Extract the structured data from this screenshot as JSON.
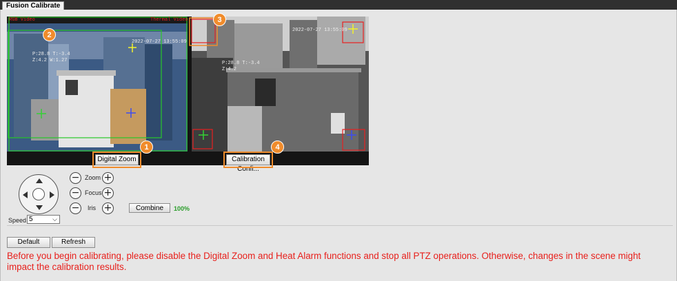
{
  "tab": {
    "label": "Fusion Calibrate"
  },
  "video": {
    "left_timestamp": "2022-07-27 13:55:09",
    "left_coords_1": "P:28.8  T:-3.4",
    "left_coords_2": "Z:4.2  W:1.27",
    "right_timestamp": "2022-07-27 13:55:09",
    "right_coords_1": "P:28.8  T:-3.4",
    "right_coords_2": "Z:4.2",
    "left_top_label": "RGB Video",
    "right_top_label": "Thermal Video"
  },
  "badges": [
    "1",
    "2",
    "3",
    "4"
  ],
  "buttons": {
    "digital_zoom": "Digital Zoom",
    "calibration_config": "Calibration Confi...",
    "combine": "Combine",
    "default": "Default",
    "refresh": "Refresh"
  },
  "ptz": {
    "zoom_label": "Zoom",
    "focus_label": "Focus",
    "iris_label": "Iris",
    "minus": "−",
    "plus": "+",
    "speed_label": "Speed",
    "speed_value": "5",
    "progress_text": "100%"
  },
  "note": "Before you begin calibrating, please disable the Digital Zoom and Heat Alarm functions and stop all PTZ operations. Otherwise, changes in the scene might impact the calibration results.",
  "colors": {
    "accent": "#f08c2c",
    "warning": "#e8201c",
    "progress": "#2a9d2a"
  }
}
